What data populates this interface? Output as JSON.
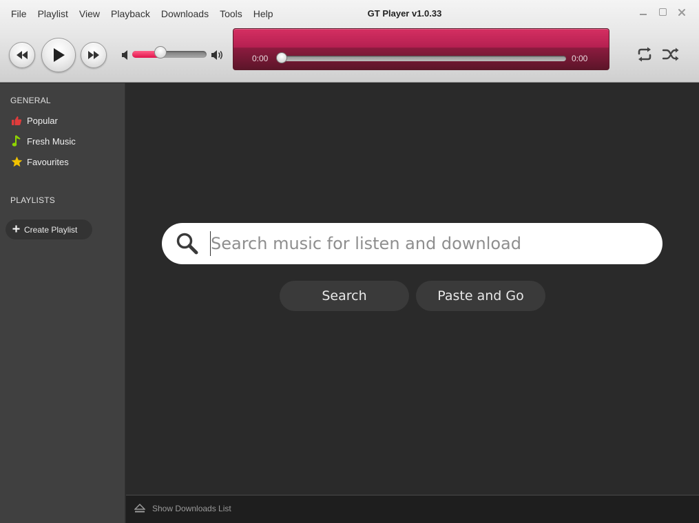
{
  "menu": {
    "items": [
      "File",
      "Playlist",
      "View",
      "Playback",
      "Downloads",
      "Tools",
      "Help"
    ]
  },
  "window": {
    "title": "GT Player v1.0.33",
    "controls": [
      "minimize-icon",
      "maximize-icon",
      "close-icon"
    ]
  },
  "player": {
    "volume_fraction": 0.38,
    "elapsed": "0:00",
    "total": "0:00",
    "progress_fraction": 0.0,
    "icons": [
      "rewind-icon",
      "play-icon",
      "fast-forward-icon",
      "volume-low-icon",
      "volume-high-icon",
      "repeat-icon",
      "shuffle-icon"
    ]
  },
  "sidebar": {
    "general_heading": "GENERAL",
    "items": [
      {
        "label": "Popular",
        "icon": "thumbs-up-icon"
      },
      {
        "label": "Fresh Music",
        "icon": "music-note-icon"
      },
      {
        "label": "Favourites",
        "icon": "star-icon"
      }
    ],
    "playlists_heading": "PLAYLISTS",
    "create_playlist_label": "Create Playlist"
  },
  "main": {
    "search_placeholder": "Search music for listen and download",
    "search_value": "",
    "search_button": "Search",
    "paste_button": "Paste and Go"
  },
  "footer": {
    "downloads_label": "Show Downloads List"
  },
  "colors": {
    "accent": "#c8245a",
    "panel_dark": "#2a2a2a",
    "sidebar": "#404040",
    "thumbs": "#e03c3c",
    "note": "#8fd400",
    "star": "#f2c200"
  }
}
